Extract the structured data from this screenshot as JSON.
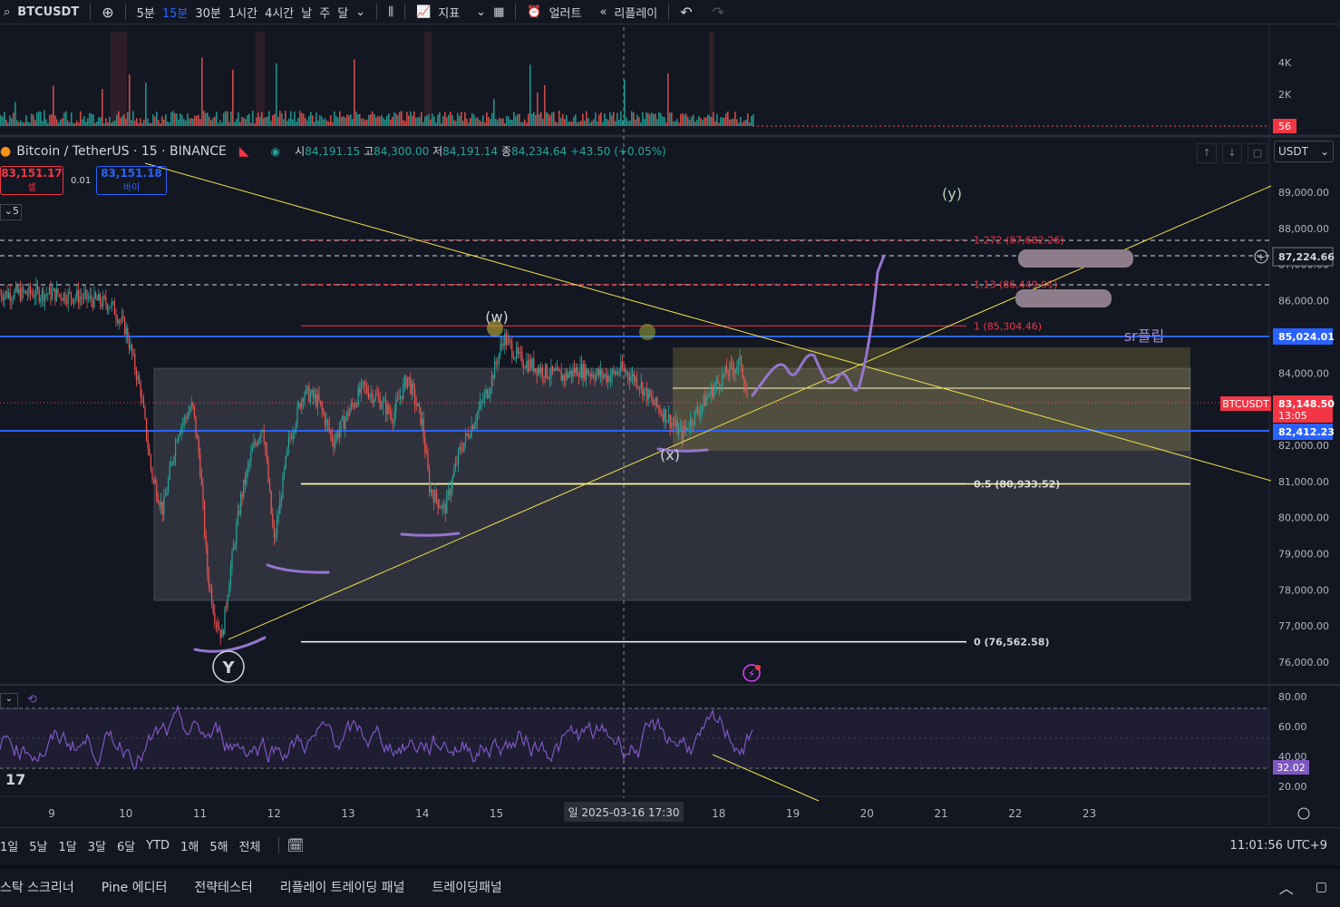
{
  "toolbar": {
    "symbol": "BTCUSDT",
    "intervals": [
      "5분",
      "15분",
      "30분",
      "1시간",
      "4시간",
      "날",
      "주",
      "달"
    ],
    "active_interval": "15분",
    "indicators_label": "지표",
    "alert_label": "얼러트",
    "replay_label": "리플레이"
  },
  "legend": {
    "title": "Bitcoin / TetherUS · 15 · BINANCE",
    "o_label": "시",
    "o": "84,191.15",
    "h_label": "고",
    "h": "84,300.00",
    "l_label": "저",
    "l": "84,191.14",
    "c_label": "종",
    "c": "84,234.64",
    "change": "+43.50 (+0.05%)"
  },
  "trade": {
    "sell_price": "83,151.17",
    "sell_label": "셀",
    "spread": "0.01",
    "buy_price": "83,151.18",
    "buy_label": "바이",
    "count": "5"
  },
  "currency": "USDT",
  "colors": {
    "background": "#131722",
    "up": "#26a69a",
    "down": "#ef5350",
    "trendline": "#f2e14c",
    "blue_level": "#2962ff",
    "fib_red": "#f23645",
    "annotation_purple": "#9575cd",
    "rsi": "#7e57c2"
  },
  "chart_data": [
    {
      "type": "candlestick",
      "title": "Bitcoin / TetherUS · 15 · BINANCE",
      "ylim": [
        75500,
        89500
      ],
      "y_ticks": [
        "89,000.00",
        "88,000.00",
        "87,000.00",
        "86,000.00",
        "85,000.00",
        "84,000.00",
        "83,000.00",
        "82,000.00",
        "81,000.00",
        "80,000.00",
        "79,000.00",
        "78,000.00",
        "77,000.00",
        "76,000.00"
      ],
      "x_ticks": [
        "9",
        "10",
        "11",
        "12",
        "13",
        "14",
        "15",
        "18",
        "19",
        "20",
        "21",
        "22",
        "23"
      ],
      "x_cursor_label": "일 2025-03-16   17:30",
      "last_price": {
        "label": "BTCUSDT",
        "value": "83,148.50",
        "countdown": "13:05"
      },
      "price_labels": [
        {
          "value": "87,224.66",
          "style": "cursor"
        },
        {
          "value": "85,024.01",
          "style": "blue"
        },
        {
          "value": "82,412.23",
          "style": "blue"
        }
      ],
      "series": [
        {
          "name": "price_path",
          "x": [
            9.0,
            9.4,
            9.8,
            10.0,
            10.2,
            10.35,
            10.5,
            10.7,
            10.9,
            11.0,
            11.1,
            11.2,
            11.3,
            11.4,
            11.55,
            11.7,
            11.85,
            12.0,
            12.2,
            12.4,
            12.6,
            12.8,
            13.0,
            13.2,
            13.4,
            13.6,
            13.8,
            14.0,
            14.1,
            14.3,
            14.5,
            14.7,
            14.9,
            15.0,
            15.1,
            15.3,
            15.5,
            15.7,
            15.9,
            16.1,
            16.3,
            16.5,
            16.7,
            16.9,
            17.1,
            17.3,
            17.5,
            17.7,
            17.9,
            18.1,
            18.3,
            18.4
          ],
          "y": [
            86200,
            86100,
            85900,
            85200,
            83500,
            81200,
            80200,
            82400,
            83100,
            81500,
            78500,
            77300,
            76700,
            78400,
            80500,
            81800,
            82600,
            79300,
            82100,
            83500,
            83200,
            82100,
            82900,
            83600,
            83300,
            82800,
            83900,
            82600,
            80800,
            80200,
            81800,
            82700,
            83600,
            84300,
            85000,
            84400,
            84200,
            84000,
            83900,
            84100,
            84000,
            83900,
            84100,
            83800,
            83200,
            82800,
            82300,
            82900,
            83500,
            84000,
            84300,
            83100
          ]
        }
      ],
      "levels": [
        {
          "label": "1.272 (87,682.26)",
          "value": 87682.26
        },
        {
          "label": "1.13 (86,449.91)",
          "value": 86449.91
        },
        {
          "label": "1 (85,304.46)",
          "value": 85304.46
        },
        {
          "label": "0.5 (80,933.52)",
          "value": 80933.52
        },
        {
          "label": "0 (76,562.58)",
          "value": 76562.58
        }
      ],
      "annotations": [
        "(w)",
        "(x)",
        "(y)",
        "Y",
        "sr플립"
      ]
    },
    {
      "type": "bar",
      "title": "volume",
      "y_ticks": [
        "4K",
        "2K"
      ],
      "last_value": "56"
    },
    {
      "type": "line",
      "title": "RSI",
      "ylim": [
        15,
        82
      ],
      "y_ticks": [
        "80.00",
        "60.00",
        "40.00",
        "20.00"
      ],
      "last_value": "32.02"
    }
  ],
  "range_buttons": [
    "1일",
    "5날",
    "1달",
    "3달",
    "6달",
    "YTD",
    "1해",
    "5해",
    "전체"
  ],
  "clock": "11:01:56 UTC+9",
  "bottom_tabs": [
    "스탁 스크리너",
    "Pine 에디터",
    "전략테스터",
    "리플레이 트레이딩 패널",
    "트레이딩패널"
  ]
}
